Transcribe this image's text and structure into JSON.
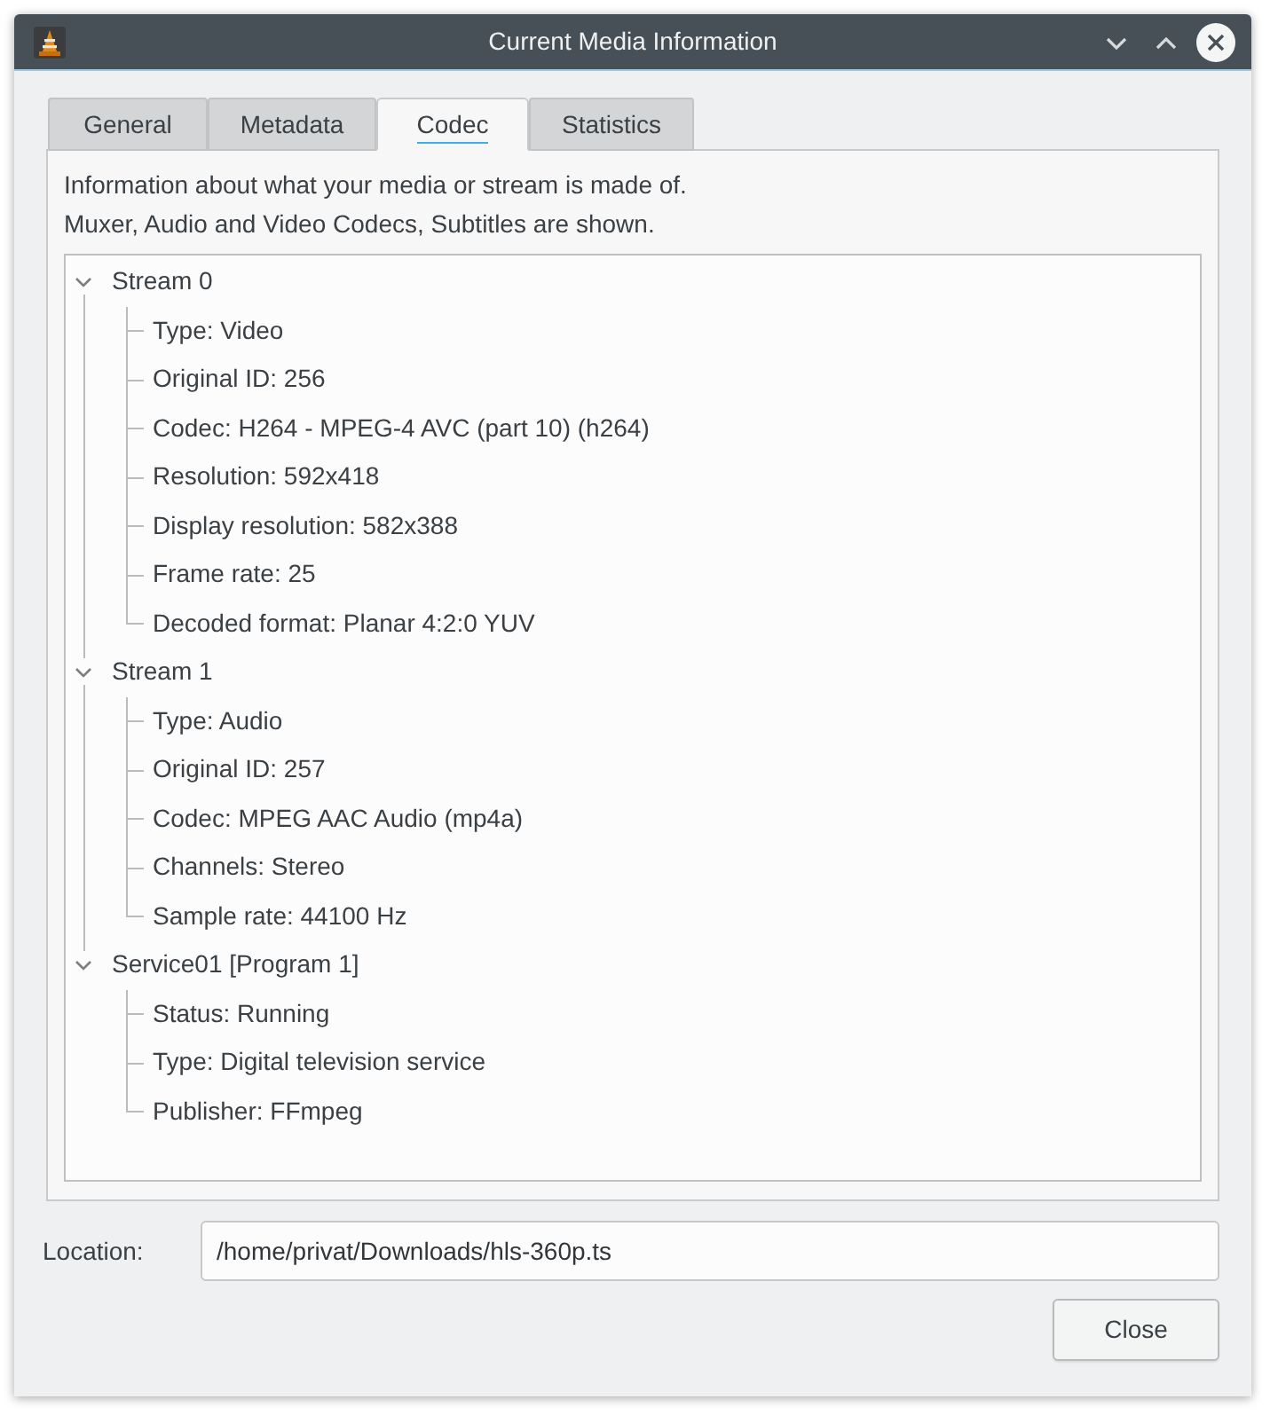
{
  "window": {
    "title": "Current Media Information"
  },
  "tabs": [
    {
      "label": "General",
      "selected": false
    },
    {
      "label": "Metadata",
      "selected": false
    },
    {
      "label": "Codec",
      "selected": true
    },
    {
      "label": "Statistics",
      "selected": false
    }
  ],
  "description": [
    "Information about what your media or stream is made of.",
    "Muxer, Audio and Video Codecs, Subtitles are shown."
  ],
  "tree": {
    "items": [
      {
        "label": "Stream 0",
        "expanded": true,
        "children": [
          {
            "label": "Type: Video"
          },
          {
            "label": "Original ID: 256"
          },
          {
            "label": "Codec: H264 - MPEG-4 AVC (part 10) (h264)"
          },
          {
            "label": "Resolution: 592x418"
          },
          {
            "label": "Display resolution: 582x388"
          },
          {
            "label": "Frame rate: 25"
          },
          {
            "label": "Decoded format: Planar 4:2:0 YUV"
          }
        ]
      },
      {
        "label": "Stream 1",
        "expanded": true,
        "children": [
          {
            "label": "Type: Audio"
          },
          {
            "label": "Original ID: 257"
          },
          {
            "label": "Codec: MPEG AAC Audio (mp4a)"
          },
          {
            "label": "Channels: Stereo"
          },
          {
            "label": "Sample rate: 44100 Hz"
          }
        ]
      },
      {
        "label": "Service01 [Program 1]",
        "expanded": true,
        "children": [
          {
            "label": "Status: Running"
          },
          {
            "label": "Type: Digital television service"
          },
          {
            "label": "Publisher: FFmpeg"
          }
        ]
      }
    ]
  },
  "location": {
    "label": "Location:",
    "value": "/home/privat/Downloads/hls-360p.ts"
  },
  "buttons": [
    {
      "label": "Close"
    }
  ]
}
